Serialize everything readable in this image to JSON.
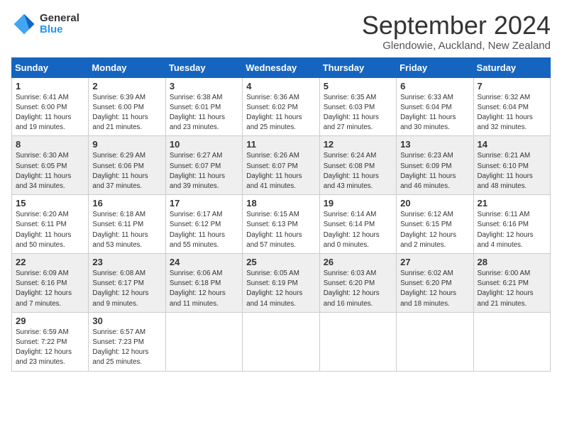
{
  "header": {
    "logo_general": "General",
    "logo_blue": "Blue",
    "month_title": "September 2024",
    "location": "Glendowie, Auckland, New Zealand"
  },
  "days_of_week": [
    "Sunday",
    "Monday",
    "Tuesday",
    "Wednesday",
    "Thursday",
    "Friday",
    "Saturday"
  ],
  "weeks": [
    [
      {
        "day": "1",
        "sunrise": "6:41 AM",
        "sunset": "6:00 PM",
        "daylight": "11 hours and 19 minutes."
      },
      {
        "day": "2",
        "sunrise": "6:39 AM",
        "sunset": "6:00 PM",
        "daylight": "11 hours and 21 minutes."
      },
      {
        "day": "3",
        "sunrise": "6:38 AM",
        "sunset": "6:01 PM",
        "daylight": "11 hours and 23 minutes."
      },
      {
        "day": "4",
        "sunrise": "6:36 AM",
        "sunset": "6:02 PM",
        "daylight": "11 hours and 25 minutes."
      },
      {
        "day": "5",
        "sunrise": "6:35 AM",
        "sunset": "6:03 PM",
        "daylight": "11 hours and 27 minutes."
      },
      {
        "day": "6",
        "sunrise": "6:33 AM",
        "sunset": "6:04 PM",
        "daylight": "11 hours and 30 minutes."
      },
      {
        "day": "7",
        "sunrise": "6:32 AM",
        "sunset": "6:04 PM",
        "daylight": "11 hours and 32 minutes."
      }
    ],
    [
      {
        "day": "8",
        "sunrise": "6:30 AM",
        "sunset": "6:05 PM",
        "daylight": "11 hours and 34 minutes."
      },
      {
        "day": "9",
        "sunrise": "6:29 AM",
        "sunset": "6:06 PM",
        "daylight": "11 hours and 37 minutes."
      },
      {
        "day": "10",
        "sunrise": "6:27 AM",
        "sunset": "6:07 PM",
        "daylight": "11 hours and 39 minutes."
      },
      {
        "day": "11",
        "sunrise": "6:26 AM",
        "sunset": "6:07 PM",
        "daylight": "11 hours and 41 minutes."
      },
      {
        "day": "12",
        "sunrise": "6:24 AM",
        "sunset": "6:08 PM",
        "daylight": "11 hours and 43 minutes."
      },
      {
        "day": "13",
        "sunrise": "6:23 AM",
        "sunset": "6:09 PM",
        "daylight": "11 hours and 46 minutes."
      },
      {
        "day": "14",
        "sunrise": "6:21 AM",
        "sunset": "6:10 PM",
        "daylight": "11 hours and 48 minutes."
      }
    ],
    [
      {
        "day": "15",
        "sunrise": "6:20 AM",
        "sunset": "6:11 PM",
        "daylight": "11 hours and 50 minutes."
      },
      {
        "day": "16",
        "sunrise": "6:18 AM",
        "sunset": "6:11 PM",
        "daylight": "11 hours and 53 minutes."
      },
      {
        "day": "17",
        "sunrise": "6:17 AM",
        "sunset": "6:12 PM",
        "daylight": "11 hours and 55 minutes."
      },
      {
        "day": "18",
        "sunrise": "6:15 AM",
        "sunset": "6:13 PM",
        "daylight": "11 hours and 57 minutes."
      },
      {
        "day": "19",
        "sunrise": "6:14 AM",
        "sunset": "6:14 PM",
        "daylight": "12 hours and 0 minutes."
      },
      {
        "day": "20",
        "sunrise": "6:12 AM",
        "sunset": "6:15 PM",
        "daylight": "12 hours and 2 minutes."
      },
      {
        "day": "21",
        "sunrise": "6:11 AM",
        "sunset": "6:16 PM",
        "daylight": "12 hours and 4 minutes."
      }
    ],
    [
      {
        "day": "22",
        "sunrise": "6:09 AM",
        "sunset": "6:16 PM",
        "daylight": "12 hours and 7 minutes."
      },
      {
        "day": "23",
        "sunrise": "6:08 AM",
        "sunset": "6:17 PM",
        "daylight": "12 hours and 9 minutes."
      },
      {
        "day": "24",
        "sunrise": "6:06 AM",
        "sunset": "6:18 PM",
        "daylight": "12 hours and 11 minutes."
      },
      {
        "day": "25",
        "sunrise": "6:05 AM",
        "sunset": "6:19 PM",
        "daylight": "12 hours and 14 minutes."
      },
      {
        "day": "26",
        "sunrise": "6:03 AM",
        "sunset": "6:20 PM",
        "daylight": "12 hours and 16 minutes."
      },
      {
        "day": "27",
        "sunrise": "6:02 AM",
        "sunset": "6:20 PM",
        "daylight": "12 hours and 18 minutes."
      },
      {
        "day": "28",
        "sunrise": "6:00 AM",
        "sunset": "6:21 PM",
        "daylight": "12 hours and 21 minutes."
      }
    ],
    [
      {
        "day": "29",
        "sunrise": "6:59 AM",
        "sunset": "7:22 PM",
        "daylight": "12 hours and 23 minutes."
      },
      {
        "day": "30",
        "sunrise": "6:57 AM",
        "sunset": "7:23 PM",
        "daylight": "12 hours and 25 minutes."
      },
      null,
      null,
      null,
      null,
      null
    ]
  ]
}
